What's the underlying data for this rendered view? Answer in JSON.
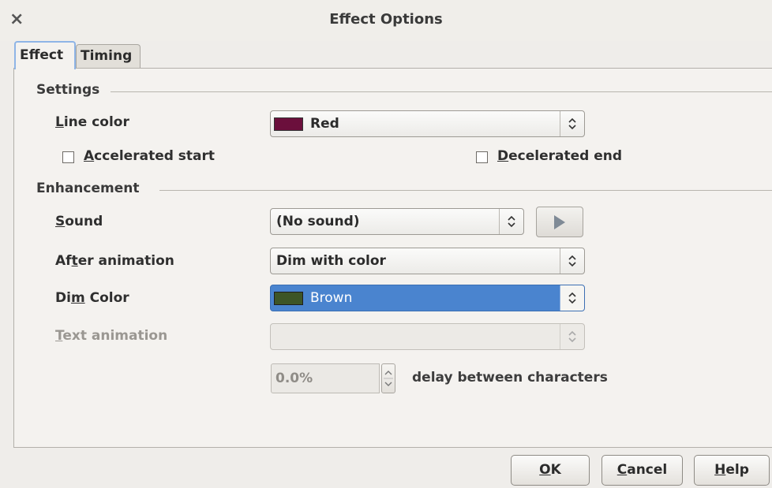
{
  "window": {
    "title": "Effect Options"
  },
  "tabs": [
    {
      "label": "Effect"
    },
    {
      "label": "Timing"
    }
  ],
  "settings": {
    "group_title": "Settings",
    "line_color_label": "Line color",
    "line_color_value": "Red",
    "line_color_swatch": "#6b0f3c",
    "accelerated_start_label": "Accelerated start",
    "decelerated_end_label": "Decelerated end"
  },
  "enhancement": {
    "group_title": "Enhancement",
    "sound_label": "Sound",
    "sound_value": "(No sound)",
    "after_animation_label": "After animation",
    "after_animation_value": "Dim with color",
    "dim_color_label": "Dim Color",
    "dim_color_value": "Brown",
    "dim_color_swatch": "#3d5527",
    "text_animation_label": "Text animation",
    "text_animation_value": "",
    "delay_value": "0.0%",
    "delay_label": "delay between characters"
  },
  "buttons": {
    "ok": "OK",
    "cancel": "Cancel",
    "help": "Help"
  },
  "colors": {
    "selection": "#4a84cf",
    "tab_focus": "#8fb5e6"
  }
}
